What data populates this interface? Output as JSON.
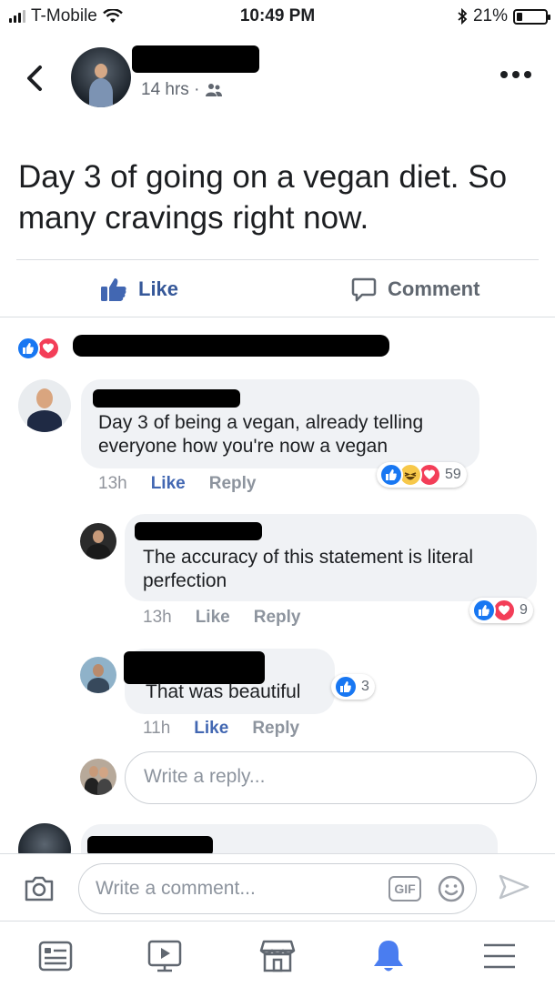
{
  "status_bar": {
    "carrier": "T-Mobile",
    "time": "10:49 PM",
    "battery": "21%",
    "battery_level": 0.21
  },
  "post": {
    "timestamp": "14 hrs ·",
    "audience_icon": "friends-icon",
    "text": "Day 3 of going on a vegan diet. So many cravings right now.",
    "like_label": "Like",
    "comment_label": "Comment"
  },
  "comments": [
    {
      "text": "Day 3 of being a vegan, already telling everyone how you're now a vegan",
      "time": "13h",
      "like": "Like",
      "reply": "Reply",
      "reaction_count": "59",
      "reactions": [
        "like",
        "haha",
        "love"
      ]
    },
    {
      "text": "The accuracy of this statement is literal perfection",
      "time": "13h",
      "like": "Like",
      "reply": "Reply",
      "reaction_count": "9",
      "reactions": [
        "like",
        "love"
      ]
    },
    {
      "text": "That was beautiful",
      "time": "11h",
      "like": "Like",
      "reply": "Reply",
      "reaction_count": "3",
      "reactions": [
        "like"
      ]
    }
  ],
  "reply_input": {
    "placeholder": "Write a reply..."
  },
  "comment_bar": {
    "placeholder": "Write a comment...",
    "gif_label": "GIF"
  },
  "tabs": [
    {
      "icon": "news-feed-icon"
    },
    {
      "icon": "watch-icon"
    },
    {
      "icon": "marketplace-icon"
    },
    {
      "icon": "notifications-icon",
      "active": true
    },
    {
      "icon": "menu-icon"
    }
  ],
  "colors": {
    "facebook_blue": "#4267b2",
    "like_blue": "#1877f2",
    "love_red": "#f33e58",
    "haha_yellow": "#f7c84a",
    "bubble_gray": "#f0f2f5"
  }
}
